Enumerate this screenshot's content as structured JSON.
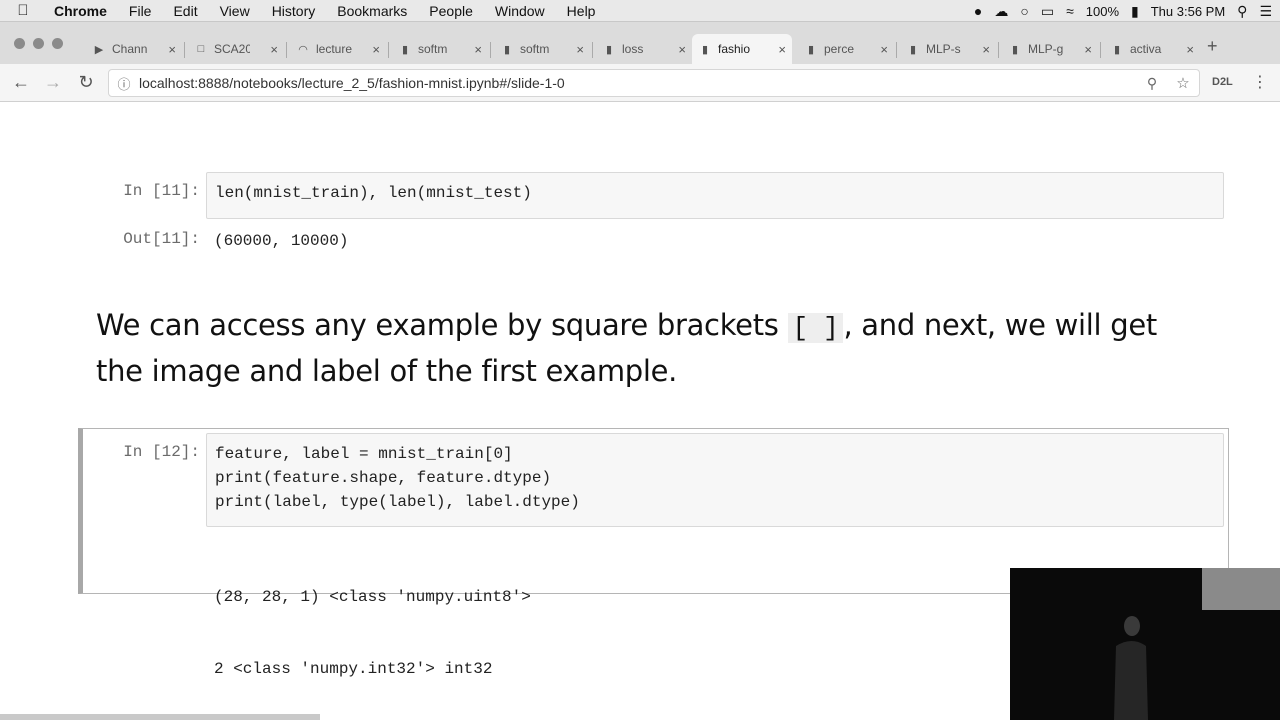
{
  "menubar": {
    "app": "Chrome",
    "items": [
      "File",
      "Edit",
      "View",
      "History",
      "Bookmarks",
      "People",
      "Window",
      "Help"
    ],
    "battery": "100%",
    "clock": "Thu 3:56 PM"
  },
  "tabs": [
    {
      "label": "Chann",
      "icon": "youtube-icon"
    },
    {
      "label": "SCA20",
      "icon": "document-icon"
    },
    {
      "label": "lecture",
      "icon": "loading-icon"
    },
    {
      "label": "softm",
      "icon": "notebook-icon"
    },
    {
      "label": "softm",
      "icon": "notebook-icon"
    },
    {
      "label": "loss",
      "icon": "notebook-icon"
    },
    {
      "label": "fashio",
      "icon": "notebook-icon",
      "active": true
    },
    {
      "label": "perce",
      "icon": "notebook-icon"
    },
    {
      "label": "MLP-s",
      "icon": "notebook-icon"
    },
    {
      "label": "MLP-g",
      "icon": "notebook-icon"
    },
    {
      "label": "activa",
      "icon": "notebook-icon"
    }
  ],
  "address": {
    "url": "localhost:8888/notebooks/lecture_2_5/fashion-mnist.ipynb#/slide-1-0",
    "extension_label": "D2L"
  },
  "cells": {
    "cell1": {
      "in_prompt": "In [11]:",
      "code": "len(mnist_train), len(mnist_test)",
      "out_prompt": "Out[11]:",
      "output": "(60000, 10000)"
    },
    "markdown": {
      "text_before": "We can access any example by square brackets ",
      "inline_code": "[ ]",
      "text_after": ", and next, we will get the image and label of the first example."
    },
    "cell2": {
      "in_prompt": "In [12]:",
      "code_lines": [
        "feature, label = mnist_train[0]",
        "print(feature.shape, feature.dtype)",
        "print(label, type(label), label.dtype)"
      ],
      "output_lines": [
        "(28, 28, 1) <class 'numpy.uint8'>",
        "2 <class 'numpy.int32'> int32"
      ]
    }
  }
}
